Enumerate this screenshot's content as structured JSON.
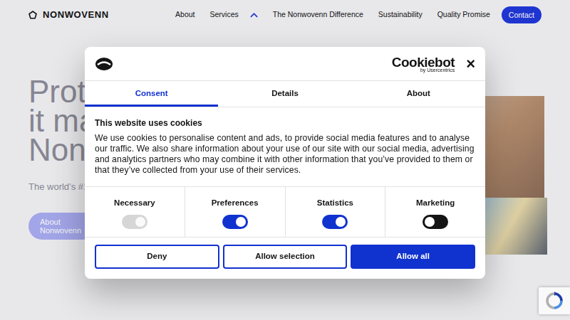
{
  "nav": {
    "logo": "NONWOVENN",
    "links": [
      {
        "label": "About",
        "kind": "link"
      },
      {
        "label": "Services",
        "kind": "dropdown",
        "expanded": true
      },
      {
        "label": "The Nonwovenn Difference",
        "kind": "link"
      },
      {
        "label": "Sustainability",
        "kind": "link"
      },
      {
        "label": "Quality Promise",
        "kind": "link"
      }
    ],
    "contact": "Contact"
  },
  "hero": {
    "title_lines": [
      "Prot",
      "it ma",
      "Nonw"
    ],
    "subtitle": "The world’s #1",
    "button": "About Nonwovenn"
  },
  "consent": {
    "brand": "Cookiebot",
    "brand_sub": "by Usercentrics",
    "close": "×",
    "tabs": [
      {
        "label": "Consent",
        "selected": true
      },
      {
        "label": "Details",
        "selected": false
      },
      {
        "label": "About",
        "selected": false
      }
    ],
    "heading": "This website uses cookies",
    "text": "We use cookies to personalise content and ads, to provide social media features and to analyse our traffic. We also share information about your use of our site with our social media, advertising and analytics partners who may combine it with other information that you’ve provided to them or that they’ve collected from your use of their services.",
    "toggles": [
      {
        "label": "Necessary",
        "on": true,
        "disabled": true
      },
      {
        "label": "Preferences",
        "on": true,
        "disabled": false
      },
      {
        "label": "Statistics",
        "on": true,
        "disabled": false
      },
      {
        "label": "Marketing",
        "on": false,
        "disabled": false
      }
    ],
    "buttons": [
      {
        "label": "Deny",
        "kind": "outline"
      },
      {
        "label": "Allow selection",
        "kind": "outline"
      },
      {
        "label": "Allow all",
        "kind": "primary"
      }
    ]
  }
}
